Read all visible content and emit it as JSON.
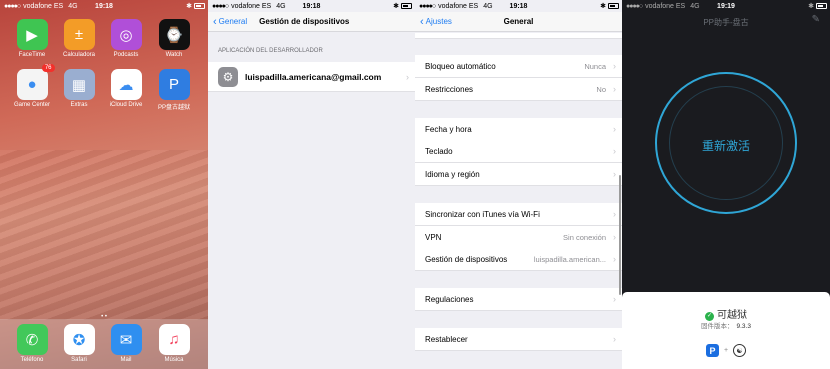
{
  "panel1": {
    "status": {
      "carrier": "vodafone ES",
      "network": "4G",
      "time": "19:18"
    },
    "apps": [
      {
        "label": "FaceTime",
        "icon": "facetime-icon",
        "color": "#3fc552",
        "glyph": "▶"
      },
      {
        "label": "Calculadora",
        "icon": "calculator-icon",
        "color": "#f39c27",
        "glyph": "±"
      },
      {
        "label": "Podcasts",
        "icon": "podcasts-icon",
        "color": "#b04fd8",
        "glyph": "◎"
      },
      {
        "label": "Watch",
        "icon": "watch-icon",
        "color": "#111111",
        "glyph": "⌚"
      },
      {
        "label": "Game Center",
        "icon": "game-center-icon",
        "color": "#f4f4f4",
        "glyph": "●",
        "badge": "76"
      },
      {
        "label": "Extras",
        "icon": "extras-folder-icon",
        "color": "#9aaed0",
        "glyph": "▦"
      },
      {
        "label": "iCloud Drive",
        "icon": "icloud-drive-icon",
        "color": "#ffffff",
        "glyph": "☁"
      },
      {
        "label": "PP盘古越狱",
        "icon": "pp-jailbreak-icon",
        "color": "#2f7de1",
        "glyph": "P"
      }
    ],
    "dock": [
      {
        "label": "Teléfono",
        "icon": "phone-icon",
        "color": "#42c85a",
        "glyph": "✆"
      },
      {
        "label": "Safari",
        "icon": "safari-icon",
        "color": "#ffffff",
        "glyph": "✪"
      },
      {
        "label": "Mail",
        "icon": "mail-icon",
        "color": "#2f8ff0",
        "glyph": "✉"
      },
      {
        "label": "Música",
        "icon": "music-icon",
        "color": "#ffffff",
        "glyph": "♫"
      }
    ],
    "page_dots": "• •"
  },
  "panel2": {
    "status": {
      "carrier": "vodafone ES",
      "network": "4G",
      "time": "19:18"
    },
    "back_label": "General",
    "title": "Gestión de dispositivos",
    "section_header": "APLICACIÓN DEL DESARROLLADOR",
    "account": "luispadilla.americana@gmail.com"
  },
  "panel3": {
    "status": {
      "carrier": "vodafone ES",
      "network": "4G",
      "time": "19:18"
    },
    "back_label": "Ajustes",
    "title": "General",
    "rows": [
      {
        "label": "Bloqueo automático",
        "value": "Nunca"
      },
      {
        "label": "Restricciones",
        "value": "No"
      },
      {
        "label": "Fecha y hora",
        "value": ""
      },
      {
        "label": "Teclado",
        "value": ""
      },
      {
        "label": "Idioma y región",
        "value": ""
      },
      {
        "label": "Sincronizar con iTunes vía Wi-Fi",
        "value": ""
      },
      {
        "label": "VPN",
        "value": "Sin conexión"
      },
      {
        "label": "Gestión de dispositivos",
        "value": "luispadilla.american..."
      },
      {
        "label": "Regulaciones",
        "value": ""
      },
      {
        "label": "Restablecer",
        "value": ""
      }
    ]
  },
  "panel4": {
    "status": {
      "carrier": "vodafone ES",
      "network": "4G",
      "time": "19:19"
    },
    "title": "PP助手-盘古",
    "button": "重新激活",
    "result": "可越狱",
    "firmware_label": "固件版本：",
    "firmware_value": "9.3.3",
    "plus": "+"
  }
}
